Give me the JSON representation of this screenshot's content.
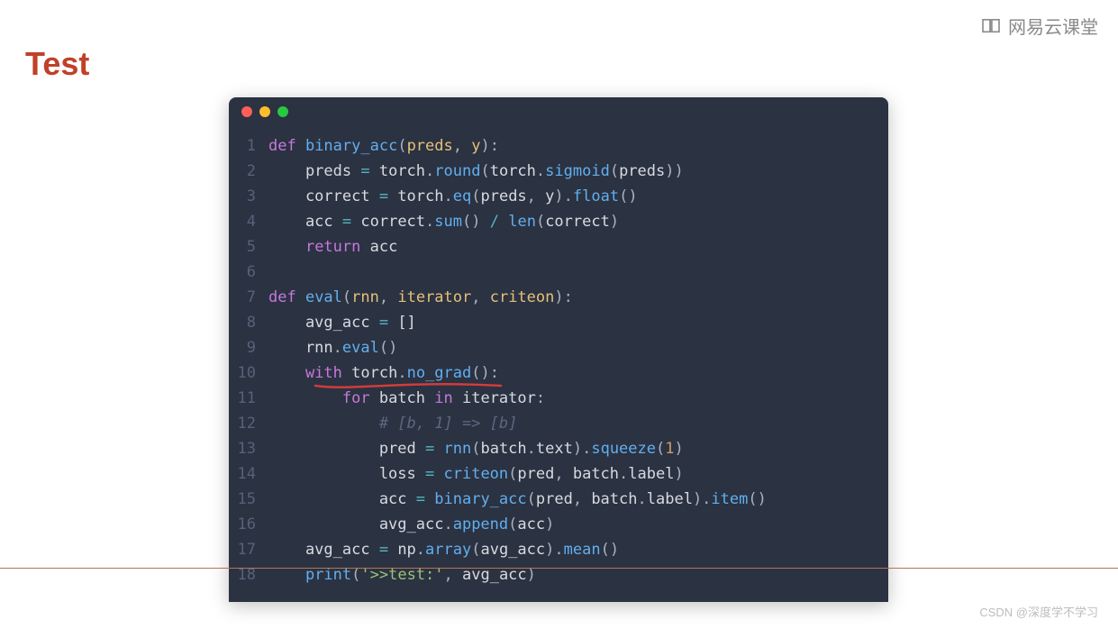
{
  "page": {
    "title": "Test",
    "brand": "网易云课堂",
    "watermark": "CSDN @深度学不学习"
  },
  "code": {
    "lines": [
      {
        "n": 1,
        "tokens": [
          [
            "kw",
            "def "
          ],
          [
            "fn",
            "binary_acc"
          ],
          [
            "punc",
            "("
          ],
          [
            "id",
            "preds"
          ],
          [
            "punc",
            ", "
          ],
          [
            "id",
            "y"
          ],
          [
            "punc",
            "):"
          ]
        ]
      },
      {
        "n": 2,
        "tokens": [
          [
            "white",
            "    preds "
          ],
          [
            "op",
            "="
          ],
          [
            "white",
            " torch"
          ],
          [
            "punc",
            "."
          ],
          [
            "fn",
            "round"
          ],
          [
            "punc",
            "("
          ],
          [
            "white",
            "torch"
          ],
          [
            "punc",
            "."
          ],
          [
            "fn",
            "sigmoid"
          ],
          [
            "punc",
            "("
          ],
          [
            "white",
            "preds"
          ],
          [
            "punc",
            "))"
          ]
        ]
      },
      {
        "n": 3,
        "tokens": [
          [
            "white",
            "    correct "
          ],
          [
            "op",
            "="
          ],
          [
            "white",
            " torch"
          ],
          [
            "punc",
            "."
          ],
          [
            "fn",
            "eq"
          ],
          [
            "punc",
            "("
          ],
          [
            "white",
            "preds"
          ],
          [
            "punc",
            ", "
          ],
          [
            "white",
            "y"
          ],
          [
            "punc",
            ")."
          ],
          [
            "fn",
            "float"
          ],
          [
            "punc",
            "()"
          ]
        ]
      },
      {
        "n": 4,
        "tokens": [
          [
            "white",
            "    acc "
          ],
          [
            "op",
            "="
          ],
          [
            "white",
            " correct"
          ],
          [
            "punc",
            "."
          ],
          [
            "fn",
            "sum"
          ],
          [
            "punc",
            "() "
          ],
          [
            "op",
            "/"
          ],
          [
            "white",
            " "
          ],
          [
            "fn",
            "len"
          ],
          [
            "punc",
            "("
          ],
          [
            "white",
            "correct"
          ],
          [
            "punc",
            ")"
          ]
        ]
      },
      {
        "n": 5,
        "tokens": [
          [
            "white",
            "    "
          ],
          [
            "kw",
            "return"
          ],
          [
            "white",
            " acc"
          ]
        ]
      },
      {
        "n": 6,
        "tokens": [
          [
            "white",
            ""
          ]
        ]
      },
      {
        "n": 7,
        "tokens": [
          [
            "kw",
            "def "
          ],
          [
            "fn",
            "eval"
          ],
          [
            "punc",
            "("
          ],
          [
            "id",
            "rnn"
          ],
          [
            "punc",
            ", "
          ],
          [
            "id",
            "iterator"
          ],
          [
            "punc",
            ", "
          ],
          [
            "id",
            "criteon"
          ],
          [
            "punc",
            "):"
          ]
        ]
      },
      {
        "n": 8,
        "tokens": [
          [
            "white",
            "    avg_acc "
          ],
          [
            "op",
            "="
          ],
          [
            "white",
            " []"
          ]
        ]
      },
      {
        "n": 9,
        "tokens": [
          [
            "white",
            "    rnn"
          ],
          [
            "punc",
            "."
          ],
          [
            "fn",
            "eval"
          ],
          [
            "punc",
            "()"
          ]
        ]
      },
      {
        "n": 10,
        "tokens": [
          [
            "white",
            "    "
          ],
          [
            "kw",
            "with"
          ],
          [
            "white",
            " torch"
          ],
          [
            "punc",
            "."
          ],
          [
            "fn",
            "no_grad"
          ],
          [
            "punc",
            "():"
          ]
        ]
      },
      {
        "n": 11,
        "tokens": [
          [
            "white",
            "        "
          ],
          [
            "kw",
            "for"
          ],
          [
            "white",
            " batch "
          ],
          [
            "kw",
            "in"
          ],
          [
            "white",
            " iterator"
          ],
          [
            "punc",
            ":"
          ]
        ]
      },
      {
        "n": 12,
        "tokens": [
          [
            "white",
            "            "
          ],
          [
            "cmt",
            "# [b, 1] => [b]"
          ]
        ]
      },
      {
        "n": 13,
        "tokens": [
          [
            "white",
            "            pred "
          ],
          [
            "op",
            "="
          ],
          [
            "white",
            " "
          ],
          [
            "fn",
            "rnn"
          ],
          [
            "punc",
            "("
          ],
          [
            "white",
            "batch"
          ],
          [
            "punc",
            "."
          ],
          [
            "white",
            "text"
          ],
          [
            "punc",
            ")."
          ],
          [
            "fn",
            "squeeze"
          ],
          [
            "punc",
            "("
          ],
          [
            "num",
            "1"
          ],
          [
            "punc",
            ")"
          ]
        ]
      },
      {
        "n": 14,
        "tokens": [
          [
            "white",
            "            loss "
          ],
          [
            "op",
            "="
          ],
          [
            "white",
            " "
          ],
          [
            "fn",
            "criteon"
          ],
          [
            "punc",
            "("
          ],
          [
            "white",
            "pred"
          ],
          [
            "punc",
            ", "
          ],
          [
            "white",
            "batch"
          ],
          [
            "punc",
            "."
          ],
          [
            "white",
            "label"
          ],
          [
            "punc",
            ")"
          ]
        ]
      },
      {
        "n": 15,
        "tokens": [
          [
            "white",
            "            acc "
          ],
          [
            "op",
            "="
          ],
          [
            "white",
            " "
          ],
          [
            "fn",
            "binary_acc"
          ],
          [
            "punc",
            "("
          ],
          [
            "white",
            "pred"
          ],
          [
            "punc",
            ", "
          ],
          [
            "white",
            "batch"
          ],
          [
            "punc",
            "."
          ],
          [
            "white",
            "label"
          ],
          [
            "punc",
            ")."
          ],
          [
            "fn",
            "item"
          ],
          [
            "punc",
            "()"
          ]
        ]
      },
      {
        "n": 16,
        "tokens": [
          [
            "white",
            "            avg_acc"
          ],
          [
            "punc",
            "."
          ],
          [
            "fn",
            "append"
          ],
          [
            "punc",
            "("
          ],
          [
            "white",
            "acc"
          ],
          [
            "punc",
            ")"
          ]
        ]
      },
      {
        "n": 17,
        "tokens": [
          [
            "white",
            "    avg_acc "
          ],
          [
            "op",
            "="
          ],
          [
            "white",
            " np"
          ],
          [
            "punc",
            "."
          ],
          [
            "fn",
            "array"
          ],
          [
            "punc",
            "("
          ],
          [
            "white",
            "avg_acc"
          ],
          [
            "punc",
            ")."
          ],
          [
            "fn",
            "mean"
          ],
          [
            "punc",
            "()"
          ]
        ]
      },
      {
        "n": 18,
        "tokens": [
          [
            "white",
            "    "
          ],
          [
            "fn",
            "print"
          ],
          [
            "punc",
            "("
          ],
          [
            "str",
            "'>>test:'"
          ],
          [
            "punc",
            ", "
          ],
          [
            "white",
            "avg_acc"
          ],
          [
            "punc",
            ")"
          ]
        ]
      }
    ]
  }
}
